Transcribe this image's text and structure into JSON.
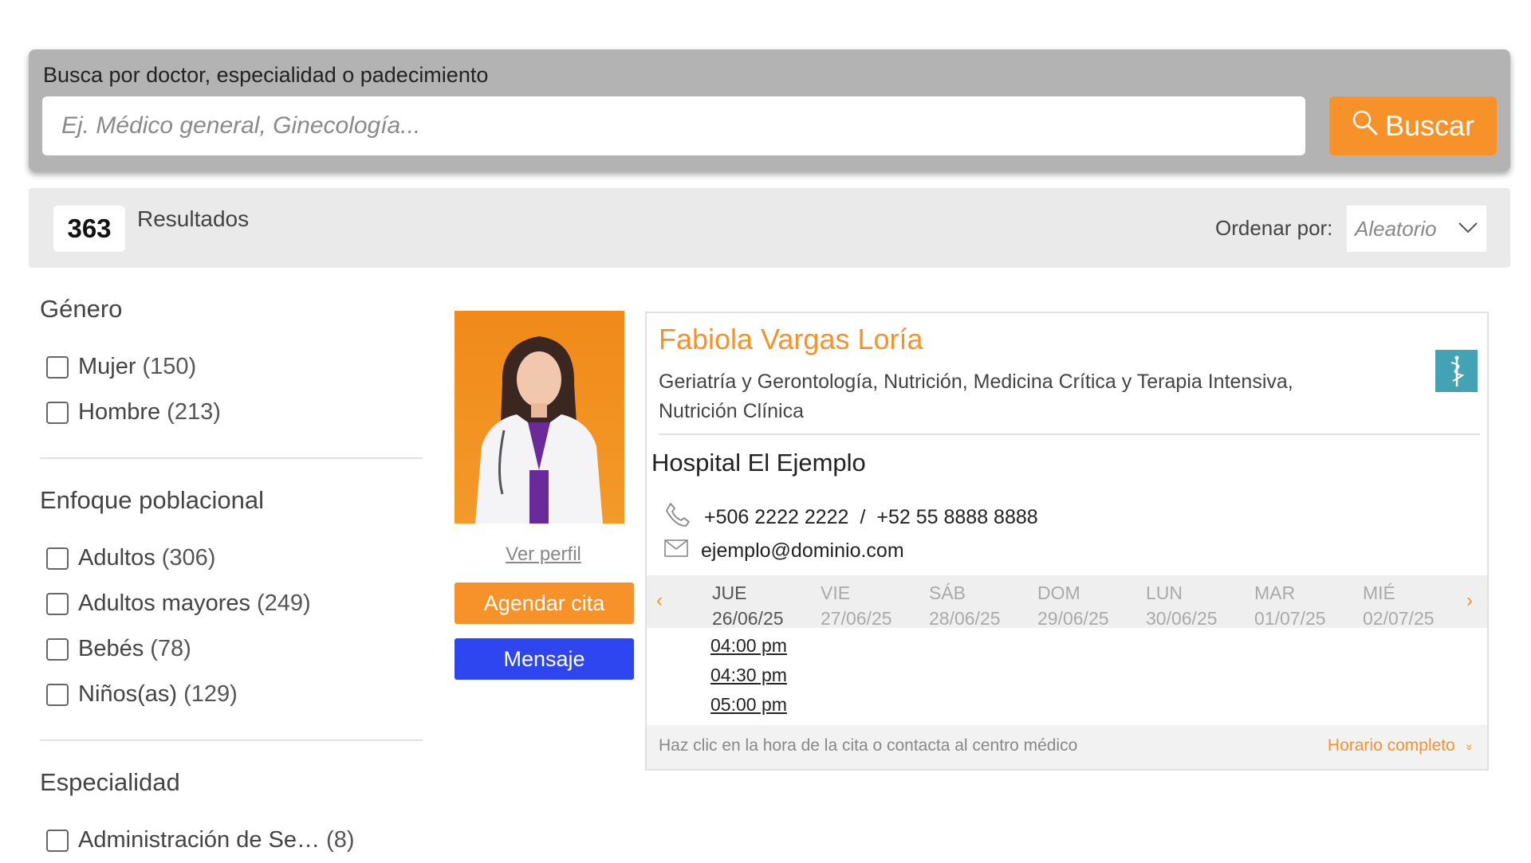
{
  "search": {
    "label": "Busca por doctor, especialidad o padecimiento",
    "placeholder": "Ej. Médico general, Ginecología...",
    "button_label": "Buscar",
    "button_icon": "search-icon"
  },
  "results": {
    "count": "363",
    "label": "Resultados",
    "sort_label": "Ordenar por:",
    "sort_value": "Aleatorio"
  },
  "filters": {
    "gender": {
      "title": "Género",
      "items": [
        {
          "label": "Mujer",
          "count": "(150)"
        },
        {
          "label": "Hombre",
          "count": "(213)"
        }
      ]
    },
    "population": {
      "title": "Enfoque poblacional",
      "items": [
        {
          "label": "Adultos",
          "count": "(306)"
        },
        {
          "label": "Adultos mayores",
          "count": "(249)"
        },
        {
          "label": "Bebés",
          "count": "(78)"
        },
        {
          "label": "Niños(as)",
          "count": "(129)"
        }
      ]
    },
    "specialty": {
      "title": "Especialidad",
      "items": [
        {
          "label": "Administración de Se…",
          "count": "(8)"
        }
      ]
    }
  },
  "doctor": {
    "view_profile": "Ver perfil",
    "book_button": "Agendar cita",
    "message_button": "Mensaje",
    "name": "Fabiola Vargas Loría",
    "specialties": "Geriatría y Gerontología, Nutrición, Medicina Crítica y Terapia Intensiva, Nutrición Clínica",
    "hospital": "Hospital El Ejemplo",
    "phone_1": "+506 2222 2222",
    "phone_sep": "/",
    "phone_2": "+52 55 8888 8888",
    "email": "ejemplo@dominio.com"
  },
  "schedule": {
    "days": [
      {
        "day": "JUE",
        "date": "26/06/25",
        "active": true
      },
      {
        "day": "VIE",
        "date": "27/06/25",
        "active": false
      },
      {
        "day": "SÁB",
        "date": "28/06/25",
        "active": false
      },
      {
        "day": "DOM",
        "date": "29/06/25",
        "active": false
      },
      {
        "day": "LUN",
        "date": "30/06/25",
        "active": false
      },
      {
        "day": "MAR",
        "date": "01/07/25",
        "active": false
      },
      {
        "day": "MIÉ",
        "date": "02/07/25",
        "active": false
      }
    ],
    "slots": [
      "04:00 pm",
      "04:30 pm",
      "05:00 pm"
    ],
    "prev_arrow": "‹",
    "next_arrow": "›",
    "hint": "Haz clic en la hora de la cita o contacta al centro médico",
    "full_schedule": "Horario completo",
    "full_schedule_icon": "»"
  },
  "colors": {
    "accent": "#f7922a",
    "message": "#2d46ef",
    "specialty_icon_bg": "#43a3b5"
  }
}
